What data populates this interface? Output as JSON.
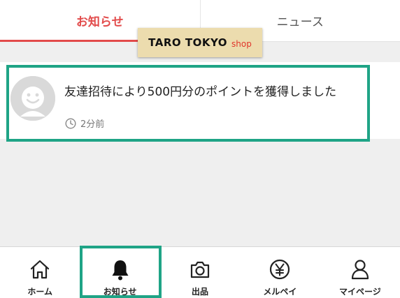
{
  "tabs": [
    {
      "label": "お知らせ",
      "active": true
    },
    {
      "label": "ニュース",
      "active": false
    }
  ],
  "watermark": {
    "brand": "TARO TOKYO",
    "suffix": "shop"
  },
  "notification": {
    "message": "友達招待により500円分のポイントを獲得しました",
    "time": "2分前",
    "avatar_icon": "user-face-icon",
    "clock_icon": "clock-icon"
  },
  "bottom_nav": [
    {
      "label": "ホーム",
      "icon": "home-icon"
    },
    {
      "label": "お知らせ",
      "icon": "bell-icon"
    },
    {
      "label": "出品",
      "icon": "camera-icon"
    },
    {
      "label": "メルペイ",
      "icon": "yen-icon"
    },
    {
      "label": "マイページ",
      "icon": "person-icon"
    }
  ],
  "colors": {
    "accent": "#e24b4b",
    "highlight": "#1fa486",
    "watermark_bg": "#ecdcae"
  }
}
